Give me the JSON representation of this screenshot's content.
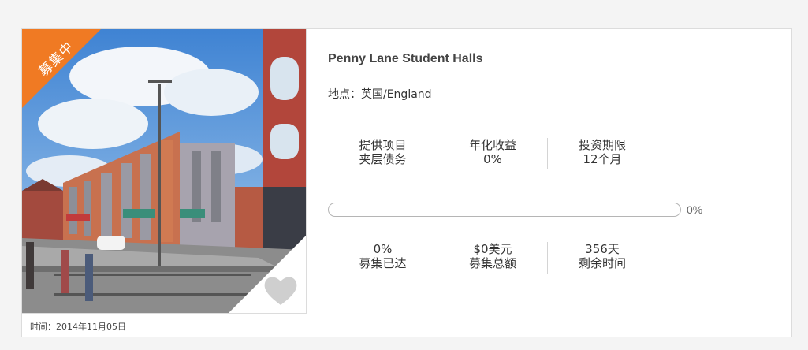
{
  "project": {
    "badge": "募集中",
    "title": "Penny Lane Student Halls",
    "location": "地点：英国/England",
    "date": "时间：2014年11月05日",
    "favorite_icon": "heart-icon",
    "accent_color": "#f07a23"
  },
  "stats_top": [
    {
      "line1": "提供项目",
      "line2": "夹层债务"
    },
    {
      "line1": "年化收益",
      "line2": "0%"
    },
    {
      "line1": "投资期限",
      "line2": "12个月"
    }
  ],
  "progress": {
    "percent": 0,
    "label": "0%"
  },
  "stats_bottom": [
    {
      "line1": "0%",
      "line2": "募集已达"
    },
    {
      "line1": "$0美元",
      "line2": "募集总额"
    },
    {
      "line1": "356天",
      "line2": "剩余时间"
    }
  ]
}
